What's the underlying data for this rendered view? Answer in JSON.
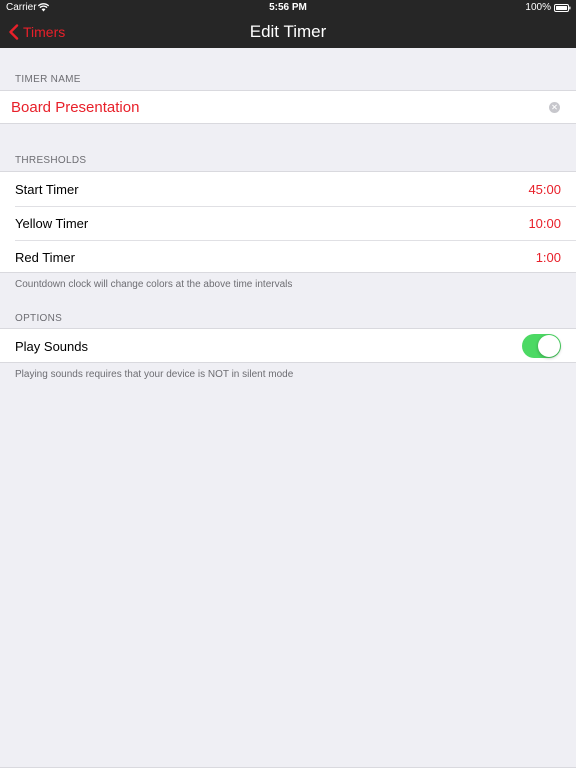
{
  "status_bar": {
    "carrier": "Carrier",
    "time": "5:56 PM",
    "battery": "100%"
  },
  "nav": {
    "back_label": "Timers",
    "title": "Edit Timer"
  },
  "timer_name": {
    "header": "TIMER NAME",
    "value": "Board Presentation"
  },
  "thresholds": {
    "header": "THRESHOLDS",
    "rows": [
      {
        "label": "Start Timer",
        "value": "45:00"
      },
      {
        "label": "Yellow Timer",
        "value": "10:00"
      },
      {
        "label": "Red Timer",
        "value": "1:00"
      }
    ],
    "footer": "Countdown clock will change colors at the above time intervals"
  },
  "options": {
    "header": "OPTIONS",
    "rows": [
      {
        "label": "Play Sounds",
        "enabled": true
      }
    ],
    "footer": "Playing sounds requires that your device is NOT in silent mode"
  },
  "colors": {
    "accent": "#e8202a",
    "nav_background": "#262626",
    "page_background": "#efeff4",
    "toggle_on": "#4cd964"
  },
  "icons": {
    "back": "chevron-left-icon",
    "wifi": "wifi-icon",
    "battery": "battery-icon",
    "clear": "clear-icon"
  }
}
